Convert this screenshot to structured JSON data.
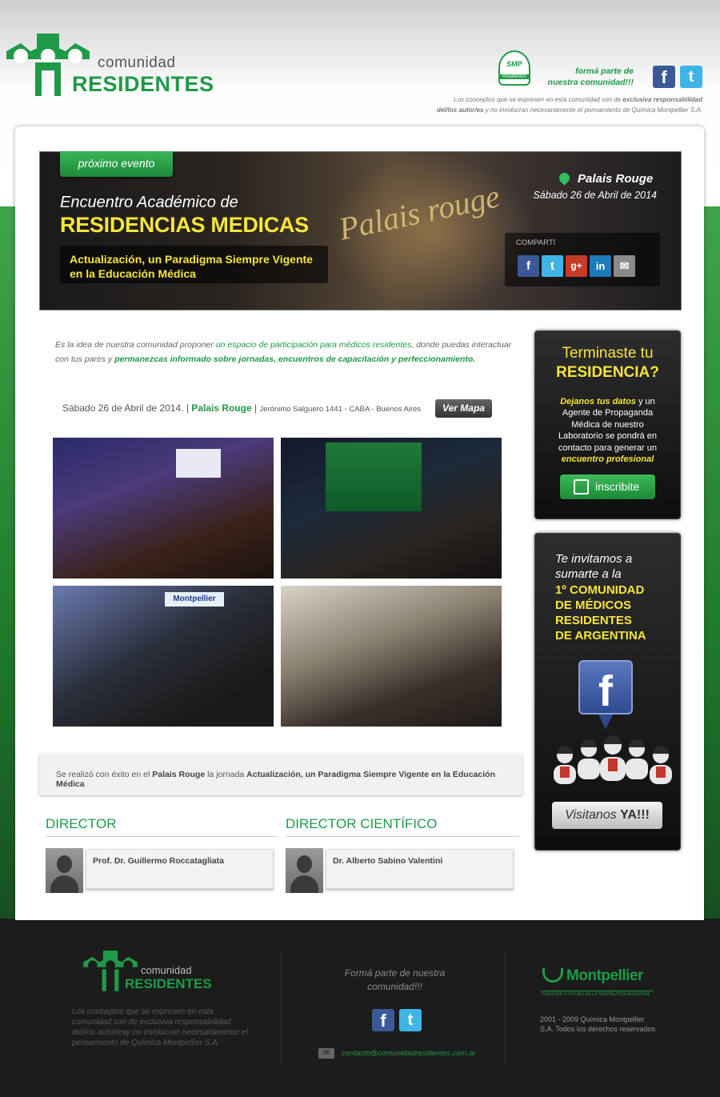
{
  "header": {
    "logo_line1": "comunidad",
    "logo_line2": "RESIDENTES",
    "smp_badge": "SMP",
    "smp_badge_sub": "Residentes",
    "join_text_1": "formá parte de",
    "join_text_2": "nuestra comunidad!!!",
    "disclaimer_1": "Los conceptos que se expresen en esta comunidad son de",
    "disclaimer_bold": "exclusiva responsabilidad",
    "disclaimer_2": "del/los autor/es",
    "disclaimer_3": "y no involucran necesariamente el pensamiento de Química Montpellier S.A."
  },
  "hero": {
    "tag": "próximo evento",
    "subtitle": "Encuentro Académico de",
    "title": "RESIDENCIAS MEDICAS",
    "tagline_1": "Actualización, un Paradigma Siempre Vigente",
    "tagline_2": "en la Educación Médica",
    "place": "Palais Rouge",
    "date": "Sábado 26 de Abril de 2014",
    "signage": "Palais rouge",
    "share_label": "COMPARTÍ"
  },
  "intro": {
    "part1": "Es la idea de nuestra comunidad proponer",
    "highlight1": "un espacio de participación para médicos residentes",
    "part2": ", donde puedas interactuar con tus pares y",
    "highlight2": "permanezcas informado sobre jornadas, encuentros de capacitación y perfeccionamiento."
  },
  "event_line": {
    "date": "Sábado 26 de Abril de 2014.",
    "sep": "|",
    "place": "Palais Rouge",
    "address": "Jerónimo Salguero 1441 - CABA - Buenos Aires",
    "map_button": "Ver Mapa"
  },
  "photo_labels": {
    "booth_sign": "Montpellier"
  },
  "summary": {
    "part1": "Se realizó con éxito en el",
    "place": "Palais Rouge",
    "part2": "la jornada",
    "event": "Actualización, un Paradigma Siempre Vigente en la Educación Médica"
  },
  "directors": [
    {
      "heading": "DIRECTOR",
      "name": "Prof. Dr. Guillermo Roccatagliata"
    },
    {
      "heading": "DIRECTOR CIENTÍFICO",
      "name": "Dr. Alberto Sabino Valentini"
    }
  ],
  "sidebar_residencia": {
    "line1": "Terminaste tu",
    "line2": "RESIDENCIA?",
    "body_bold": "Dejanos tus datos",
    "body_1": "y un Agente de Propaganda Médica de nuestro Laboratorio se pondrá en contacto para generar un",
    "body_bold2": "encuentro profesional",
    "button": "inscribite"
  },
  "sidebar_facebook": {
    "line1": "Te invitamos a",
    "line2": "sumarte a la",
    "line3": "1º COMUNIDAD",
    "line4": "DE MÉDICOS",
    "line5": "RESIDENTES",
    "line6": "DE ARGENTINA",
    "button_pre": "Visitanos",
    "button_bold": "YA!!!"
  },
  "footer": {
    "logo_line1": "comunidad",
    "logo_line2": "RESIDENTES",
    "disclaimer": "Los conceptos que se expresen en esta comunidad son de exclusiva responsabilidad del/los autor/esy no involucran necesariamente el pensamiento de Química Montpellier S.A.",
    "join_1": "Formá parte de nuestra",
    "join_2": "comunidad!!!",
    "email": "contacto@comunidadresidentes.com.ar",
    "brand": "Montpellier",
    "brand_tagline": "TRADICIÓN Y FUTURO EN LA TERAPÉUTICA ARGENTINA",
    "copyright_1": "2001 - 2009 Química Montpellier",
    "copyright_2": "S.A. Todos los derechos reservados."
  },
  "colors": {
    "brand_green": "#1f9a48",
    "accent_yellow": "#f6e53a",
    "facebook": "#3b5998",
    "twitter": "#3fb5e5"
  }
}
